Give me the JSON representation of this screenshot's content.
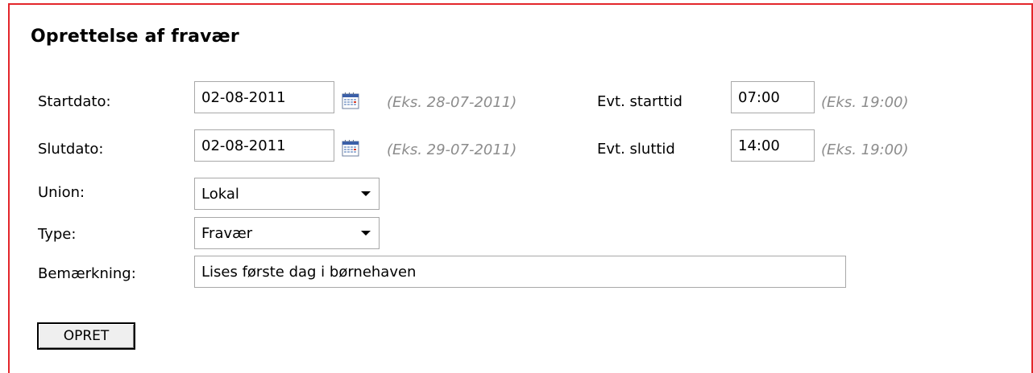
{
  "form": {
    "title": "Oprettelse af fravær",
    "startdato": {
      "label": "Startdato:",
      "value": "02-08-2011",
      "hint": "(Eks. 28-07-2011)",
      "time_label": "Evt. starttid",
      "time_value": "07:00",
      "time_hint": "(Eks. 19:00)"
    },
    "slutdato": {
      "label": "Slutdato:",
      "value": "02-08-2011",
      "hint": "(Eks. 29-07-2011)",
      "time_label": "Evt. sluttid",
      "time_value": "14:00",
      "time_hint": "(Eks. 19:00)"
    },
    "union": {
      "label": "Union:",
      "value": "Lokal"
    },
    "type": {
      "label": "Type:",
      "value": "Fravær"
    },
    "bemaerkning": {
      "label": "Bemærkning:",
      "value": "Lises første dag i børnehaven"
    },
    "submit_label": "OPRET"
  },
  "colors": {
    "border": "#e3262b",
    "hint": "#8c8c8c"
  },
  "icons": {
    "calendar": "calendar-icon",
    "dropdown": "chevron-down-icon"
  }
}
